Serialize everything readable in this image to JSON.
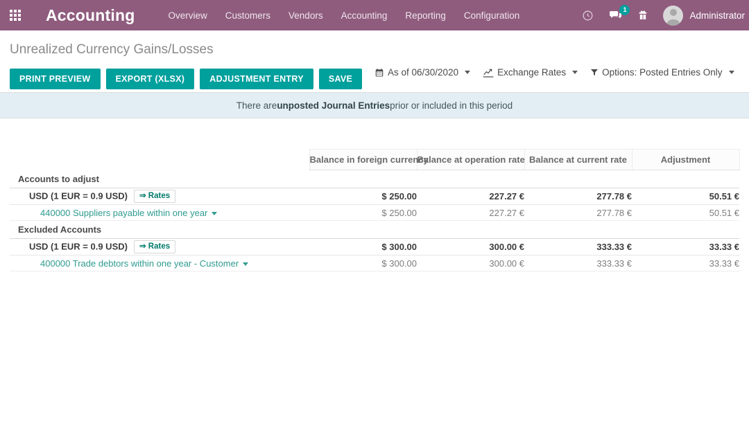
{
  "navbar": {
    "apps_icon": "apps-grid-icon",
    "brand": "Accounting",
    "menu": [
      {
        "label": "Overview"
      },
      {
        "label": "Customers"
      },
      {
        "label": "Vendors"
      },
      {
        "label": "Accounting"
      },
      {
        "label": "Reporting"
      },
      {
        "label": "Configuration"
      }
    ],
    "icons": {
      "clock": "clock-icon",
      "messages": "chat-bubble-icon",
      "message_count": "1",
      "gift": "gift-icon"
    },
    "user": {
      "name": "Administrator",
      "avatar": "user-avatar-icon"
    },
    "background": "#8f5c7e",
    "accent": "#00a09d"
  },
  "page": {
    "title": "Unrealized Currency Gains/Losses"
  },
  "toolbar": {
    "buttons": [
      {
        "label": "PRINT PREVIEW"
      },
      {
        "label": "EXPORT (XLSX)"
      },
      {
        "label": "ADJUSTMENT ENTRY"
      },
      {
        "label": "SAVE"
      }
    ],
    "filters": [
      {
        "icon": "calendar-icon",
        "label": "As of 06/30/2020",
        "caret": true
      },
      {
        "icon": "chart-line-icon",
        "label": "Exchange Rates",
        "caret": true
      },
      {
        "icon": "filter-icon",
        "label": "Options: Posted Entries Only",
        "caret": true
      }
    ]
  },
  "banner": {
    "prefix": "There are ",
    "bold": "unposted Journal Entries",
    "suffix": " prior or included in this period"
  },
  "table": {
    "columns": [
      "Balance in foreign currency",
      "Balance at operation rate",
      "Balance at current rate",
      "Adjustment"
    ],
    "sections": [
      {
        "title": "Accounts to adjust",
        "total": {
          "label": "USD (1 EUR = 0.9 USD)",
          "badge": "⇒ Rates",
          "values": [
            "$ 250.00",
            "227.27 €",
            "277.78 €",
            "50.51 €"
          ]
        },
        "rows": [
          {
            "label": "440000 Suppliers payable within one year",
            "values": [
              "$ 250.00",
              "227.27 €",
              "277.78 €",
              "50.51 €"
            ]
          }
        ]
      },
      {
        "title": "Excluded Accounts",
        "total": {
          "label": "USD (1 EUR = 0.9 USD)",
          "badge": "⇒ Rates",
          "values": [
            "$ 300.00",
            "300.00 €",
            "333.33 €",
            "33.33 €"
          ]
        },
        "rows": [
          {
            "label": "400000 Trade debtors within one year - Customer",
            "values": [
              "$ 300.00",
              "300.00 €",
              "333.33 €",
              "33.33 €"
            ]
          }
        ]
      }
    ]
  }
}
